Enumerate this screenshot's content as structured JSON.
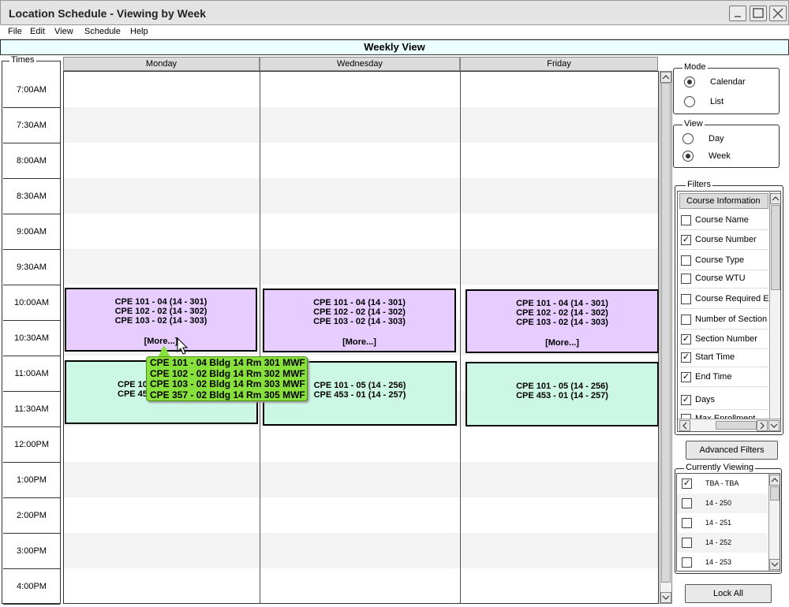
{
  "window": {
    "title": "Location Schedule - Viewing by Week"
  },
  "menu": [
    "File",
    "Edit",
    "View",
    "Schedule",
    "Help"
  ],
  "view_title": "Weekly View",
  "times": {
    "legend": "Times",
    "slots": [
      "7:00AM",
      "7:30AM",
      "8:00AM",
      "8:30AM",
      "9:00AM",
      "9:30AM",
      "10:00AM",
      "10:30AM",
      "11:00AM",
      "11:30AM",
      "12:00PM",
      "1:00PM",
      "2:00PM",
      "3:00PM",
      "4:00PM"
    ]
  },
  "days": [
    "Monday",
    "Wednesday",
    "Friday"
  ],
  "blocks": {
    "morning": [
      "CPE 101 - 04 (14 - 301)",
      "CPE 102 - 02 (14 - 302)",
      "CPE 103 - 02 (14 - 303)"
    ],
    "more": "[More...]",
    "late": [
      "CPE 101 - 05 (14 - 256)",
      "CPE 453 - 01 (14 - 257)"
    ],
    "monday_late_partial": [
      "CPE 10",
      "CPE 45"
    ]
  },
  "tooltip": [
    "CPE 101 - 04 Bldg 14 Rm 301 MWF",
    "CPE 102 - 02 Bldg 14 Rm 302 MWF",
    "CPE 103 - 02 Bldg 14 Rm 303 MWF",
    "CPE 357 - 02 Bldg 14 Rm 305 MWF"
  ],
  "mode": {
    "legend": "Mode",
    "options": [
      "Calendar",
      "List"
    ],
    "selected": "Calendar"
  },
  "view": {
    "legend": "View",
    "options": [
      "Day",
      "Week"
    ],
    "selected": "Week"
  },
  "filters": {
    "legend": "Filters",
    "header": "Course Information",
    "items": [
      {
        "label": "Course Name",
        "checked": false
      },
      {
        "label": "Course Number",
        "checked": true
      },
      {
        "label": "Course Type",
        "checked": false
      },
      {
        "label": "Course WTU",
        "checked": false
      },
      {
        "label": "Course Required E",
        "checked": false
      },
      {
        "label": "Number of Section",
        "checked": false
      },
      {
        "label": "Section Number",
        "checked": true
      },
      {
        "label": "Start Time",
        "checked": true
      },
      {
        "label": "End Time",
        "checked": true
      },
      {
        "label": "Days",
        "checked": true
      },
      {
        "label": "Max Enrollment",
        "checked": false
      }
    ]
  },
  "advanced_filters_label": "Advanced Filters",
  "currently_viewing": {
    "legend": "Currently Viewing",
    "items": [
      {
        "label": "TBA - TBA",
        "checked": true
      },
      {
        "label": "14 - 250",
        "checked": false
      },
      {
        "label": "14 - 251",
        "checked": false
      },
      {
        "label": "14 - 252",
        "checked": false
      },
      {
        "label": "14 - 253",
        "checked": false
      }
    ]
  },
  "lock_all_label": "Lock All"
}
